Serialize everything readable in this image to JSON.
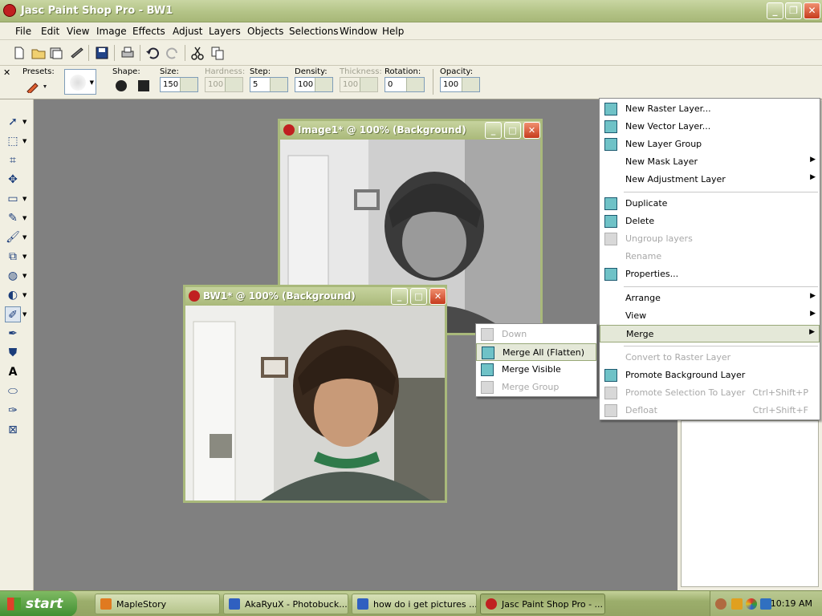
{
  "window": {
    "title": "Jasc Paint Shop Pro - BW1"
  },
  "menubar": [
    "File",
    "Edit",
    "View",
    "Image",
    "Effects",
    "Adjust",
    "Layers",
    "Objects",
    "Selections",
    "Window",
    "Help"
  ],
  "options": {
    "presets": "Presets:",
    "shape": "Shape:",
    "size": {
      "label": "Size:",
      "value": "150"
    },
    "hardness": {
      "label": "Hardness:",
      "value": "100"
    },
    "step": {
      "label": "Step:",
      "value": "5"
    },
    "density": {
      "label": "Density:",
      "value": "100"
    },
    "thickness": {
      "label": "Thickness:",
      "value": "100"
    },
    "rotation": {
      "label": "Rotation:",
      "value": "0"
    },
    "opacity": {
      "label": "Opacity:",
      "value": "100"
    }
  },
  "documents": {
    "image1": {
      "title": "Image1* @ 100% (Background)"
    },
    "bw1": {
      "title": "BW1* @ 100% (Background)"
    }
  },
  "layers_menu": [
    {
      "label": "New Raster Layer...",
      "enabled": true
    },
    {
      "label": "New Vector Layer...",
      "enabled": true
    },
    {
      "label": "New Layer Group",
      "enabled": true
    },
    {
      "label": "New Mask Layer",
      "enabled": true,
      "submenu": true
    },
    {
      "label": "New Adjustment Layer",
      "enabled": true,
      "submenu": true
    },
    {
      "label": "Duplicate",
      "enabled": true
    },
    {
      "label": "Delete",
      "enabled": true
    },
    {
      "label": "Ungroup layers",
      "enabled": false
    },
    {
      "label": "Rename",
      "enabled": false
    },
    {
      "label": "Properties...",
      "enabled": true
    },
    {
      "label": "Arrange",
      "enabled": true,
      "submenu": true
    },
    {
      "label": "View",
      "enabled": true,
      "submenu": true
    },
    {
      "label": "Merge",
      "enabled": true,
      "submenu": true
    },
    {
      "label": "Convert to Raster Layer",
      "enabled": false
    },
    {
      "label": "Promote Background Layer",
      "enabled": true
    },
    {
      "label": "Promote Selection To Layer",
      "enabled": false,
      "shortcut": "Ctrl+Shift+P"
    },
    {
      "label": "Defloat",
      "enabled": false,
      "shortcut": "Ctrl+Shift+F"
    }
  ],
  "merge_submenu": [
    {
      "label": "Down",
      "enabled": false
    },
    {
      "label": "Merge All (Flatten)",
      "enabled": true,
      "highlighted": true
    },
    {
      "label": "Merge Visible",
      "enabled": true
    },
    {
      "label": "Merge Group",
      "enabled": false
    }
  ],
  "taskbar": {
    "start": "start",
    "tasks": [
      "MapleStory",
      "AkaRyuX - Photobuck...",
      "how do i get pictures ...",
      "Jasc Paint Shop Pro - ..."
    ],
    "clock": "10:19 AM"
  },
  "colors": {
    "accent": "#a9b97b",
    "workspace": "#808080",
    "taskbar": "#9cae6c"
  }
}
